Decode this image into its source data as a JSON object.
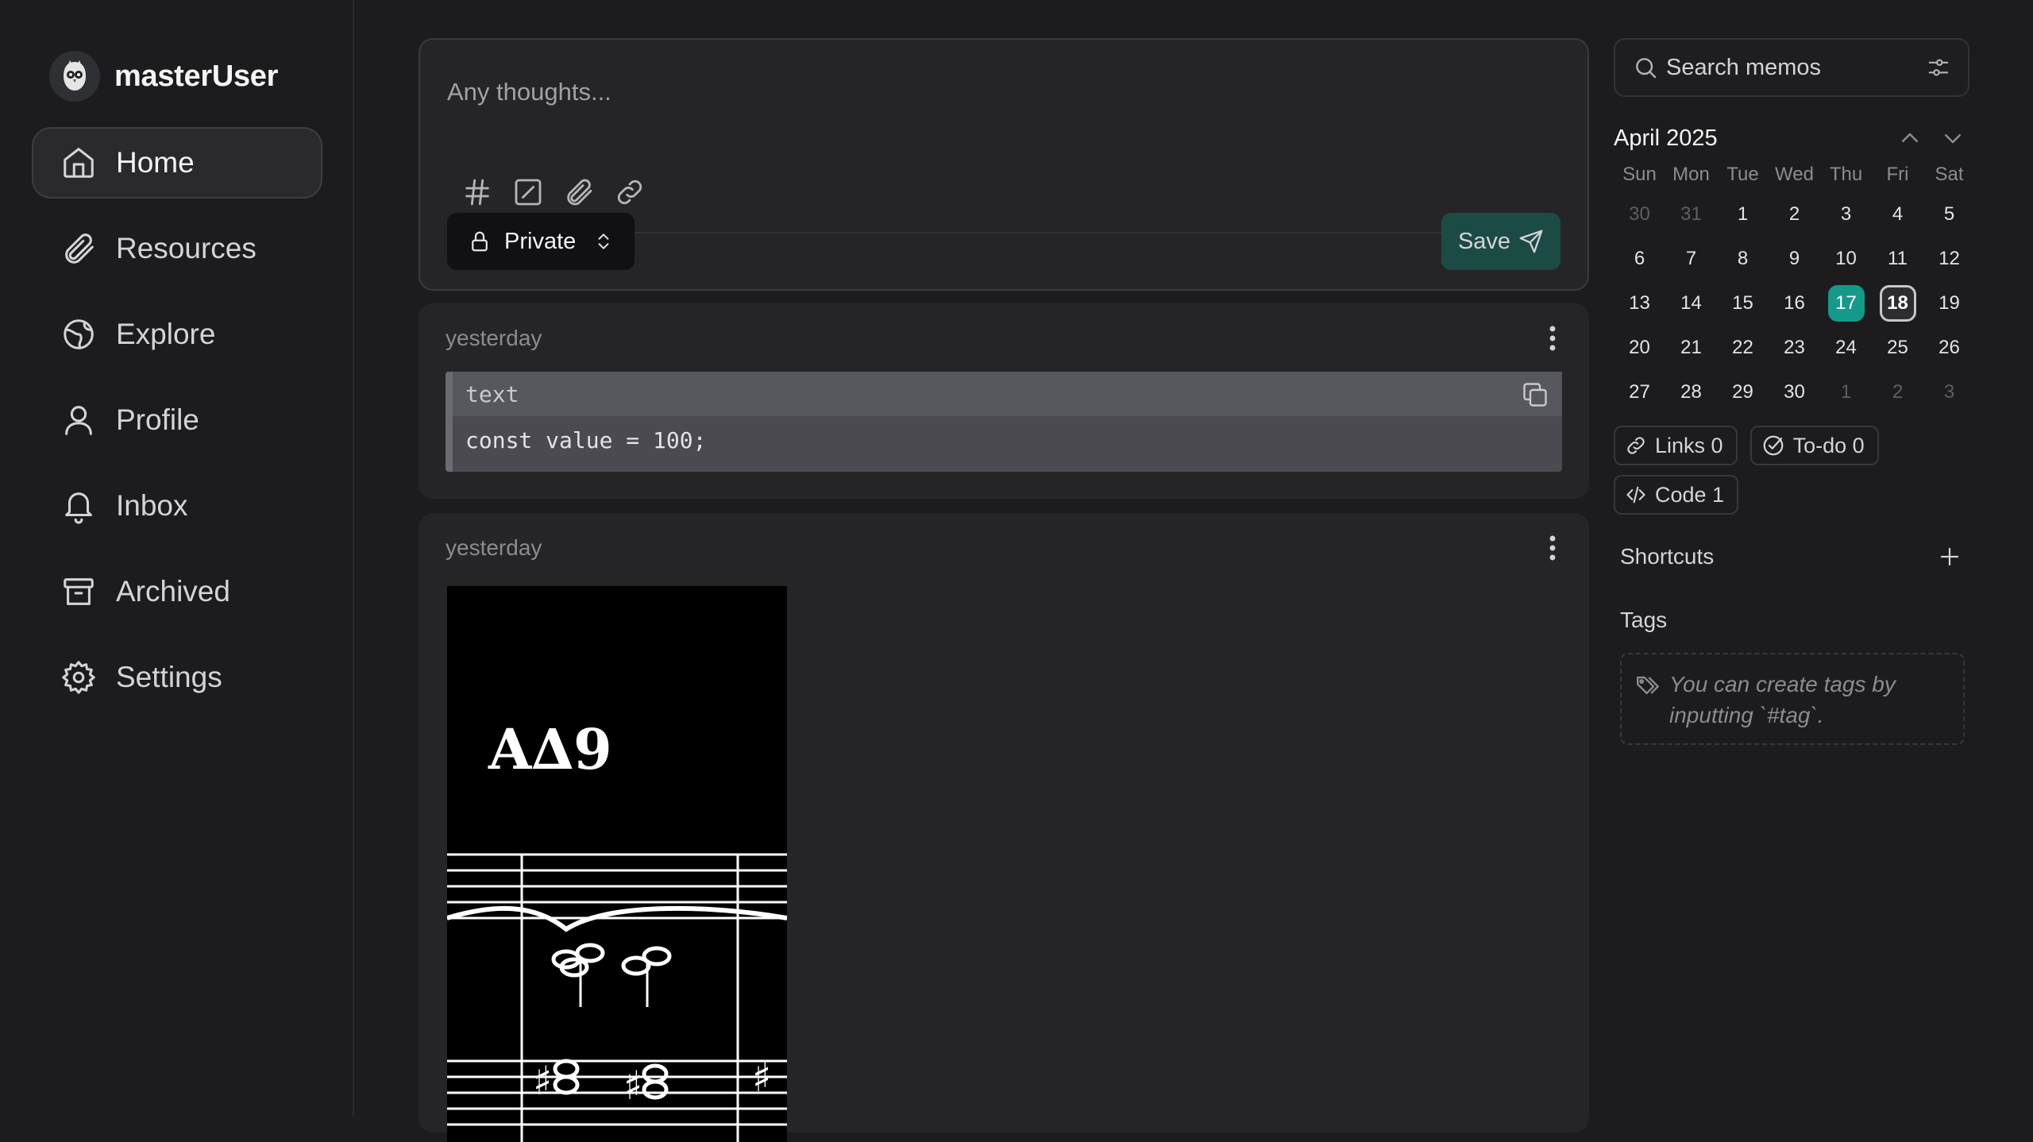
{
  "user": {
    "name": "masterUser"
  },
  "nav": [
    {
      "label": "Home",
      "icon": "home-icon",
      "active": true
    },
    {
      "label": "Resources",
      "icon": "paperclip-icon"
    },
    {
      "label": "Explore",
      "icon": "globe-icon"
    },
    {
      "label": "Profile",
      "icon": "user-icon"
    },
    {
      "label": "Inbox",
      "icon": "bell-icon"
    },
    {
      "label": "Archived",
      "icon": "archive-icon"
    },
    {
      "label": "Settings",
      "icon": "gear-icon"
    }
  ],
  "editor": {
    "placeholder": "Any thoughts...",
    "visibility": "Private",
    "save_label": "Save"
  },
  "memos": [
    {
      "time": "yesterday",
      "code": {
        "language": "text",
        "content": "const value = 100;"
      }
    },
    {
      "time": "yesterday",
      "image_text": "A∆9"
    }
  ],
  "search": {
    "placeholder": "Search memos"
  },
  "calendar": {
    "month": "April 2025",
    "weekdays": [
      "Sun",
      "Mon",
      "Tue",
      "Wed",
      "Thu",
      "Fri",
      "Sat"
    ],
    "days": [
      [
        "30",
        "31",
        "1",
        "2",
        "3",
        "4",
        "5"
      ],
      [
        "6",
        "7",
        "8",
        "9",
        "10",
        "11",
        "12"
      ],
      [
        "13",
        "14",
        "15",
        "16",
        "17",
        "18",
        "19"
      ],
      [
        "20",
        "21",
        "22",
        "23",
        "24",
        "25",
        "26"
      ],
      [
        "27",
        "28",
        "29",
        "30",
        "1",
        "2",
        "3"
      ]
    ],
    "active_day": "17",
    "today": "18"
  },
  "stats": {
    "links": "Links 0",
    "todo": "To-do 0",
    "code": "Code 1"
  },
  "shortcuts": {
    "title": "Shortcuts"
  },
  "tags": {
    "title": "Tags",
    "empty_line1": "You can create tags by",
    "empty_line2": "inputting `#tag`."
  },
  "colors": {
    "accent": "#15998a",
    "save_button": "#1c4a45",
    "background": "#1c1c1e"
  }
}
